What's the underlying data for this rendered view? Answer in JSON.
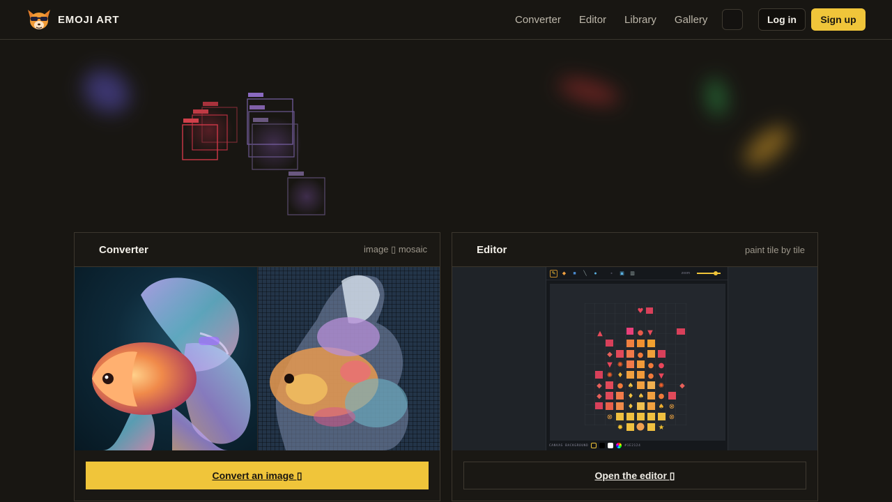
{
  "brand": {
    "name": "EMOJI ART"
  },
  "nav": {
    "links": [
      {
        "label": "Converter"
      },
      {
        "label": "Editor"
      },
      {
        "label": "Library"
      },
      {
        "label": "Gallery"
      }
    ],
    "login_label": "Log in",
    "signup_label": "Sign up"
  },
  "converter_card": {
    "title": "Converter",
    "subtitle": "image ▯ mosaic",
    "cta_label": "Convert an image ▯"
  },
  "editor_card": {
    "title": "Editor",
    "subtitle": "paint tile by tile",
    "cta_label": "Open the editor ▯",
    "preview": {
      "zoom_label": "zoom",
      "status_label": "CANVAS BACKGROUND",
      "color_value": "#1E2124"
    }
  },
  "colors": {
    "accent": "#F0C53A",
    "background": "#181612",
    "border": "#3C372E"
  },
  "icons": {
    "logo": "cool-fox-emoji-icon",
    "theme_toggle": "theme-toggle-icon"
  }
}
